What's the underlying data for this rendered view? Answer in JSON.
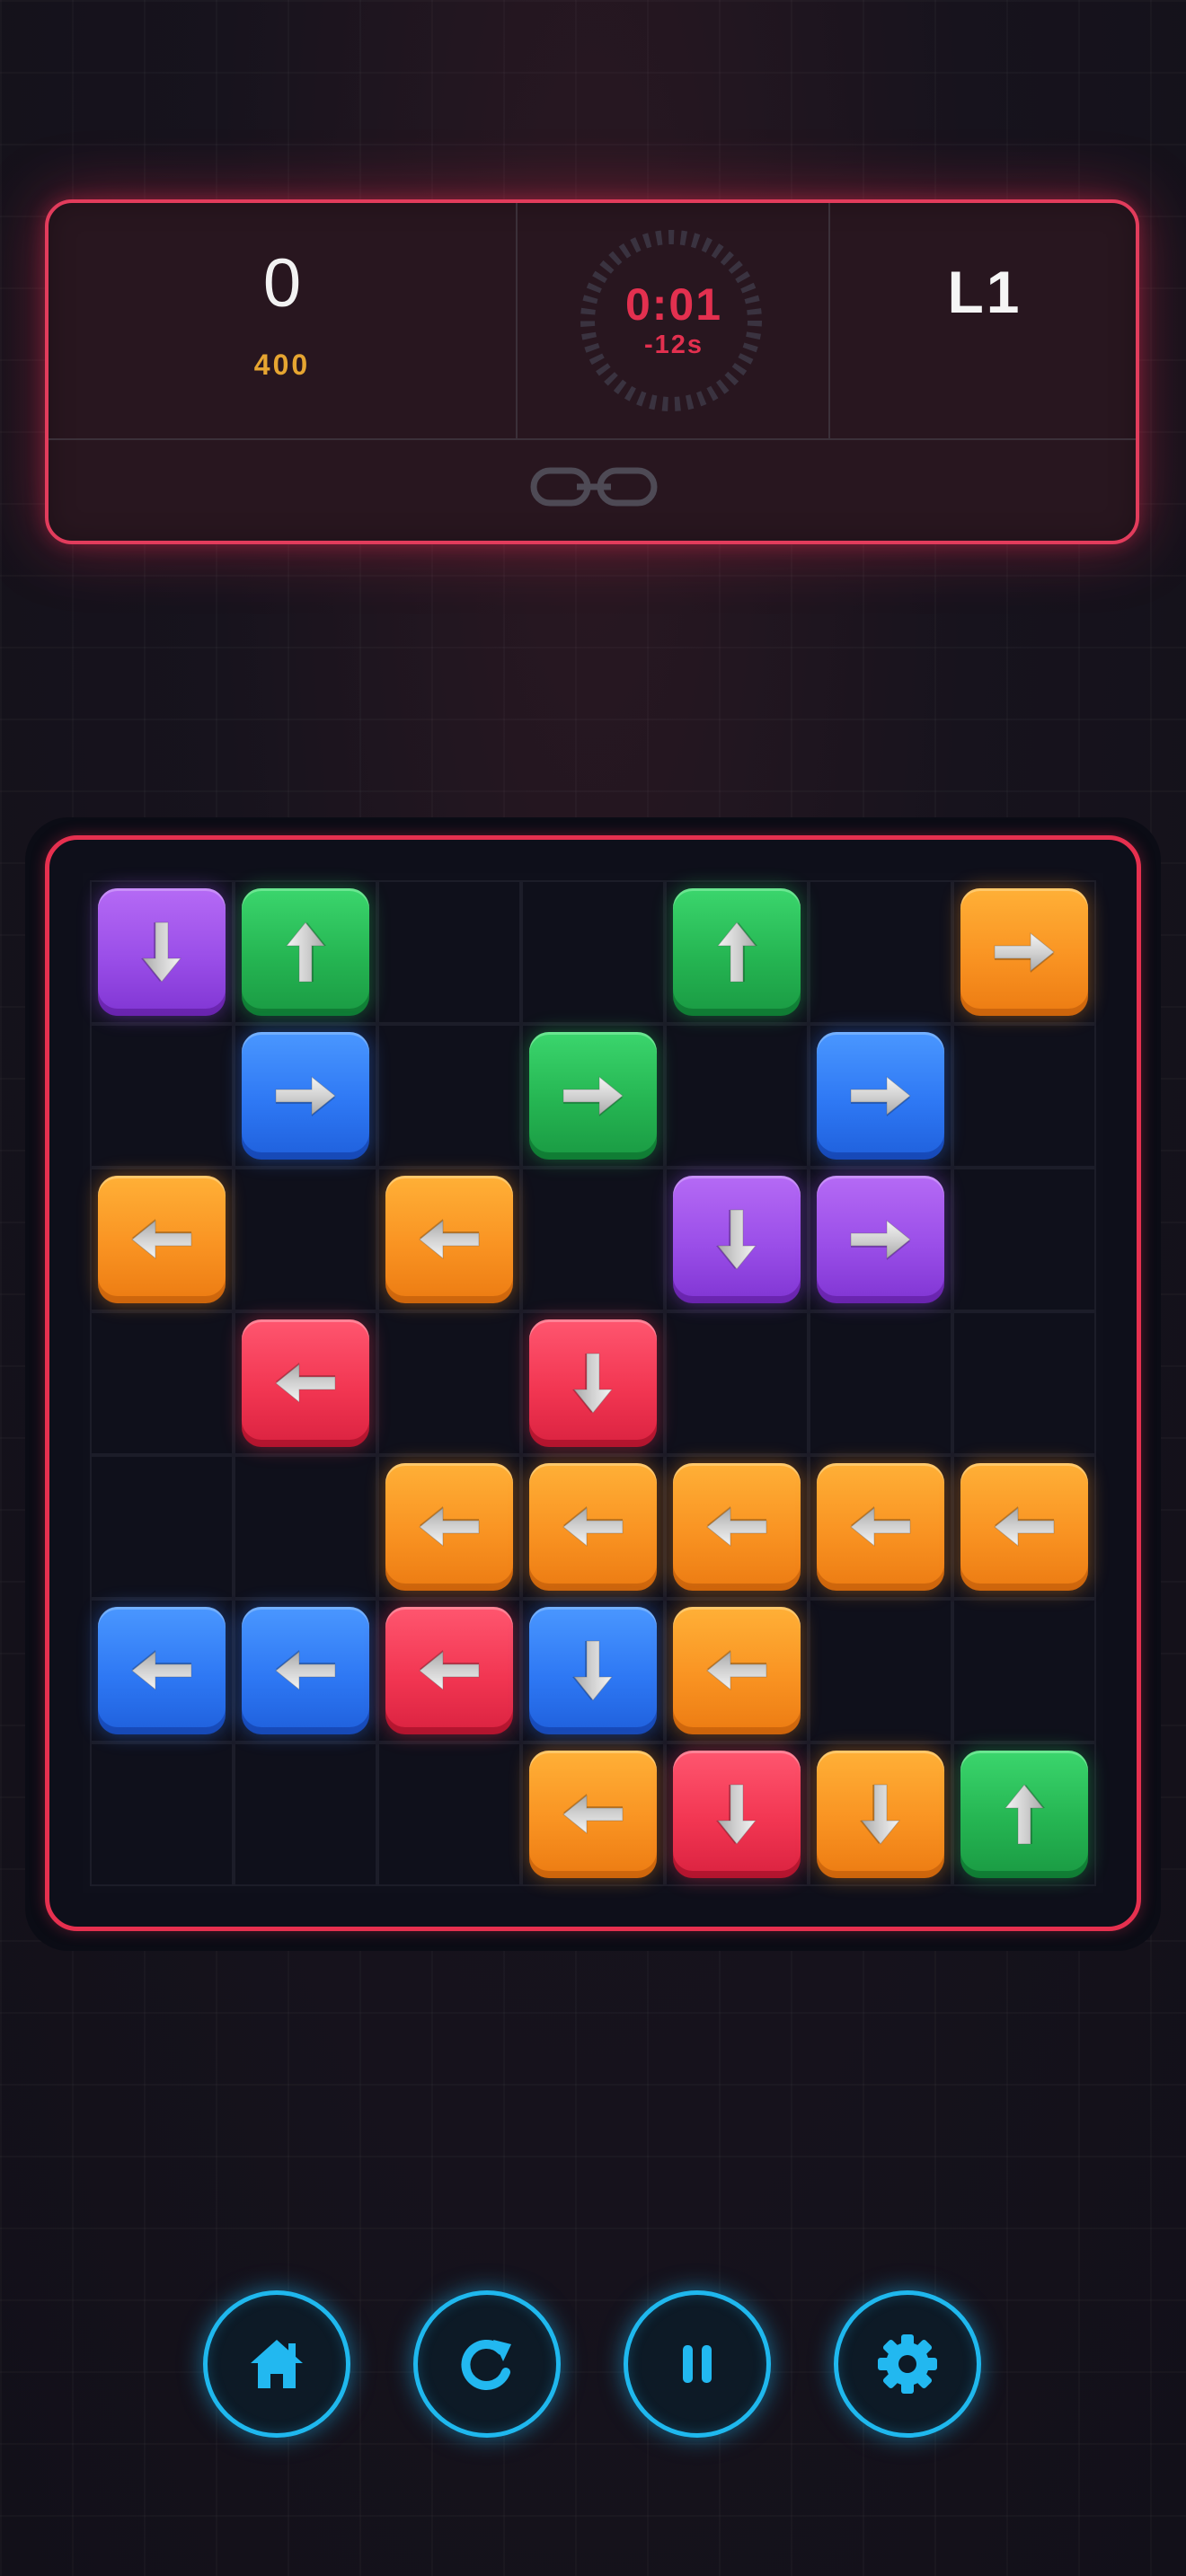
{
  "hud": {
    "score": "0",
    "target": "400",
    "timer": "0:01",
    "penalty": "-12s",
    "level": "L1"
  },
  "colors": {
    "orange": "#f99322",
    "green": "#25b552",
    "blue": "#2e78f4",
    "purple": "#9a4ee8",
    "red": "#f23652",
    "accent_frame": "#e6304f",
    "control_accent": "#1fb8ee"
  },
  "board": {
    "rows": 7,
    "cols": 7,
    "tiles": [
      {
        "row": 0,
        "col": 0,
        "color": "purple",
        "dir": "down"
      },
      {
        "row": 0,
        "col": 1,
        "color": "green",
        "dir": "up"
      },
      {
        "row": 0,
        "col": 4,
        "color": "green",
        "dir": "up"
      },
      {
        "row": 0,
        "col": 6,
        "color": "orange",
        "dir": "right"
      },
      {
        "row": 1,
        "col": 1,
        "color": "blue",
        "dir": "right"
      },
      {
        "row": 1,
        "col": 3,
        "color": "green",
        "dir": "right"
      },
      {
        "row": 1,
        "col": 5,
        "color": "blue",
        "dir": "right"
      },
      {
        "row": 2,
        "col": 0,
        "color": "orange",
        "dir": "left"
      },
      {
        "row": 2,
        "col": 2,
        "color": "orange",
        "dir": "left"
      },
      {
        "row": 2,
        "col": 4,
        "color": "purple",
        "dir": "down"
      },
      {
        "row": 2,
        "col": 5,
        "color": "purple",
        "dir": "right"
      },
      {
        "row": 3,
        "col": 1,
        "color": "red",
        "dir": "left"
      },
      {
        "row": 3,
        "col": 3,
        "color": "red",
        "dir": "down"
      },
      {
        "row": 4,
        "col": 2,
        "color": "orange",
        "dir": "left"
      },
      {
        "row": 4,
        "col": 3,
        "color": "orange",
        "dir": "left"
      },
      {
        "row": 4,
        "col": 4,
        "color": "orange",
        "dir": "left"
      },
      {
        "row": 4,
        "col": 5,
        "color": "orange",
        "dir": "left"
      },
      {
        "row": 4,
        "col": 6,
        "color": "orange",
        "dir": "left"
      },
      {
        "row": 5,
        "col": 0,
        "color": "blue",
        "dir": "left"
      },
      {
        "row": 5,
        "col": 1,
        "color": "blue",
        "dir": "left"
      },
      {
        "row": 5,
        "col": 2,
        "color": "red",
        "dir": "left"
      },
      {
        "row": 5,
        "col": 3,
        "color": "blue",
        "dir": "down"
      },
      {
        "row": 5,
        "col": 4,
        "color": "orange",
        "dir": "left"
      },
      {
        "row": 6,
        "col": 3,
        "color": "orange",
        "dir": "left"
      },
      {
        "row": 6,
        "col": 4,
        "color": "red",
        "dir": "down"
      },
      {
        "row": 6,
        "col": 5,
        "color": "orange",
        "dir": "down"
      },
      {
        "row": 6,
        "col": 6,
        "color": "green",
        "dir": "up"
      }
    ]
  },
  "controls": [
    {
      "id": "home",
      "icon": "home-icon"
    },
    {
      "id": "restart",
      "icon": "restart-icon"
    },
    {
      "id": "pause",
      "icon": "pause-icon"
    },
    {
      "id": "settings",
      "icon": "gear-icon"
    }
  ]
}
